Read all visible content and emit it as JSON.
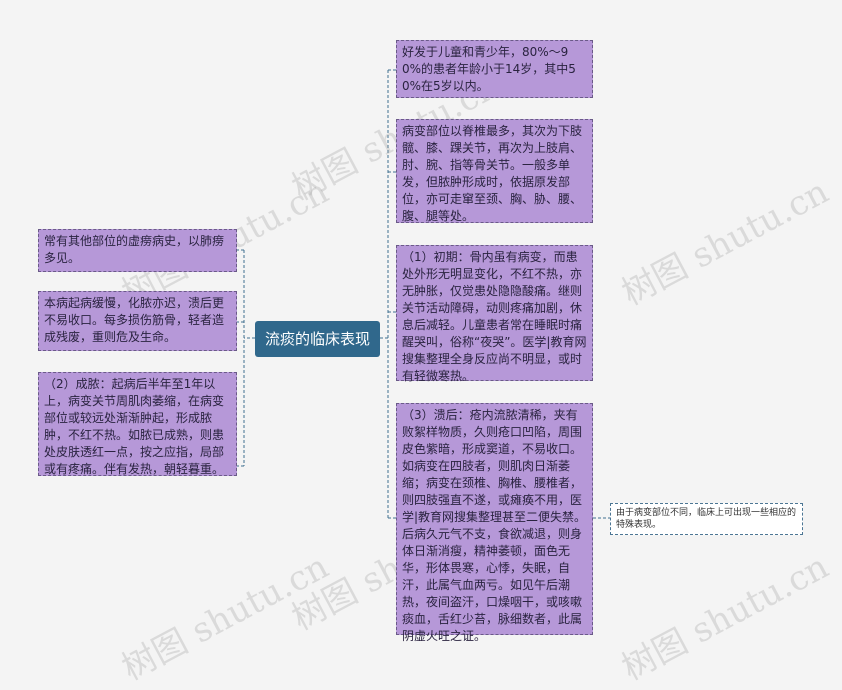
{
  "root": {
    "label": "流痰的临床表现"
  },
  "left_nodes": [
    {
      "text": "常有其他部位的虚痨病史，以肺痨多见。"
    },
    {
      "text": "本病起病缓慢，化脓亦迟，溃后更不易收口。每多损伤筋骨，轻者造成残废，重则危及生命。"
    },
    {
      "text": "（2）成脓：起病后半年至1年以上，病变关节周肌肉萎缩，在病变部位或较远处渐渐肿起，形成脓肿，不红不热。如脓已成熟，则患处皮肤透红一点，按之应指，局部或有疼痛。伴有发热，朝轻暮重。"
    }
  ],
  "right_nodes": [
    {
      "text": "好发于儿童和青少年，80%～90%的患者年龄小于14岁，其中50%在5岁以内。"
    },
    {
      "text": "病变部位以脊椎最多，其次为下肢髋、膝、踝关节，再次为上肢肩、肘、腕、指等骨关节。一般多单发，但脓肿形成时，依据原发部位，亦可走窜至颈、胸、胁、腰、腹、腿等处。"
    },
    {
      "text": "（1）初期：骨内虽有病变，而患处外形无明显变化，不红不热，亦无肿胀，仅觉患处隐隐酸痛。继则关节活动障碍，动则疼痛加剧，休息后减轻。儿童患者常在睡眠时痛醒哭叫，俗称“夜哭”。医学|教育网搜集整理全身反应尚不明显，或时有轻微寒热。"
    },
    {
      "text": "（3）溃后：疮内流脓清稀，夹有败絮样物质，久则疮口凹陷，周围皮色紫暗，形成窦道，不易收口。如病变在四肢者，则肌肉日渐萎缩；病变在颈椎、胸椎、腰椎者，则四肢强直不遂，或瘫痪不用，医学|教育网搜集整理甚至二便失禁。后病久元气不支，食欲减退，则身体日渐消瘦，精神萎顿，面色无华，形体畏寒，心悸，失眠，自汗，此属气血两亏。如见午后潮热，夜间盗汗，口燥咽干，或咳嗽痰血，舌红少苔，脉细数者，此属阴虚火旺之证。"
    }
  ],
  "note": {
    "text": "由于病变部位不同，临床上可出现一些相应的特殊表现。"
  },
  "watermark": {
    "text": "树图 shutu.cn"
  },
  "colors": {
    "node_fill": "#b698d8",
    "root_fill": "#30688c",
    "connector": "#3f6f8f"
  }
}
